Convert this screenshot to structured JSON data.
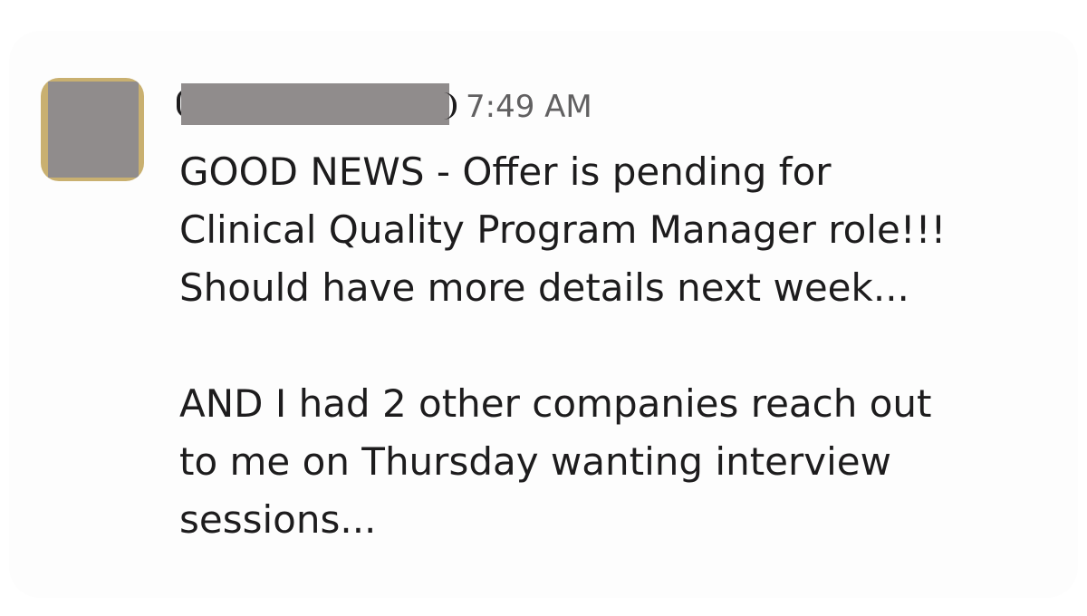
{
  "message": {
    "timestamp": "7:49 AM",
    "author_name": "",
    "lines": [
      "GOOD NEWS - Offer is pending for",
      "Clinical Quality Program Manager role!!!",
      "Should have more details next week...",
      "",
      "AND I had 2 other companies reach out",
      "to me on Thursday wanting interview",
      "sessions..."
    ]
  },
  "colors": {
    "text": "#1d1c1d",
    "timestamp": "#616061",
    "redaction": "#908c8c",
    "avatar_edge": "#c9b070"
  },
  "icons": {
    "avatar": "user-avatar-redacted"
  }
}
